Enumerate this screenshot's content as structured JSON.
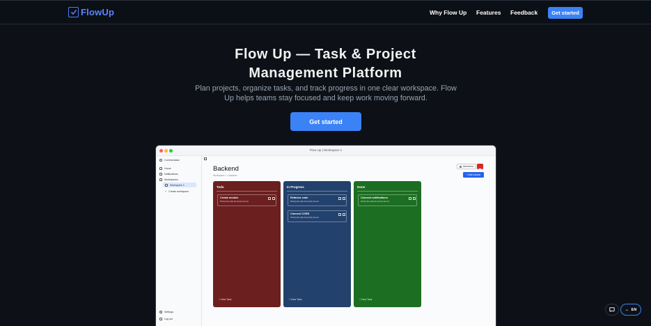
{
  "nav": {
    "brand": "FlowUp",
    "links": [
      "Why Flow Up",
      "Features",
      "Feedback"
    ],
    "cta": "Get started"
  },
  "hero": {
    "title": "Flow Up — Task & Project Management Platform",
    "subtitle": "Plan projects, organize tasks, and track progress in one clear workspace. Flow Up helps teams stay focused and keep work moving forward.",
    "cta": "Get started"
  },
  "app": {
    "window_title": "Flow Up | Workspace 1",
    "sidebar": {
      "user": "Commentator",
      "items": [
        "Home",
        "Notifications",
        "Workspaces"
      ],
      "workspace": "Workspace 1",
      "create": "Create workspace",
      "footer": [
        "Settings",
        "Log out"
      ]
    },
    "board": {
      "title": "Backend",
      "breadcrumb": "Workspace 1  >  backend",
      "members_label": "Members",
      "add_column_label": "+ Add column",
      "new_task_label": "+ New Task",
      "columns": [
        {
          "name": "Todo",
          "color": "#6b1f1f",
          "cards": [
            {
              "title": "Create module",
              "meta": "Priority   Due date   No priority   Not set"
            }
          ]
        },
        {
          "name": "In Progress",
          "color": "#23416d",
          "cards": [
            {
              "title": "Refactor code",
              "meta": "Priority   Due date   No priority   Not set"
            },
            {
              "title": "Connect CORS",
              "meta": "Priority   Due date   No priority   Not set"
            }
          ]
        },
        {
          "name": "Done",
          "color": "#1c6e22",
          "cards": [
            {
              "title": "Connect notifications",
              "meta": "Priority   Due date   No priority   Not set"
            }
          ]
        }
      ]
    }
  },
  "floating": {
    "language": "EN"
  },
  "colors": {
    "accent": "#3b82f6",
    "background": "#0d1117"
  }
}
